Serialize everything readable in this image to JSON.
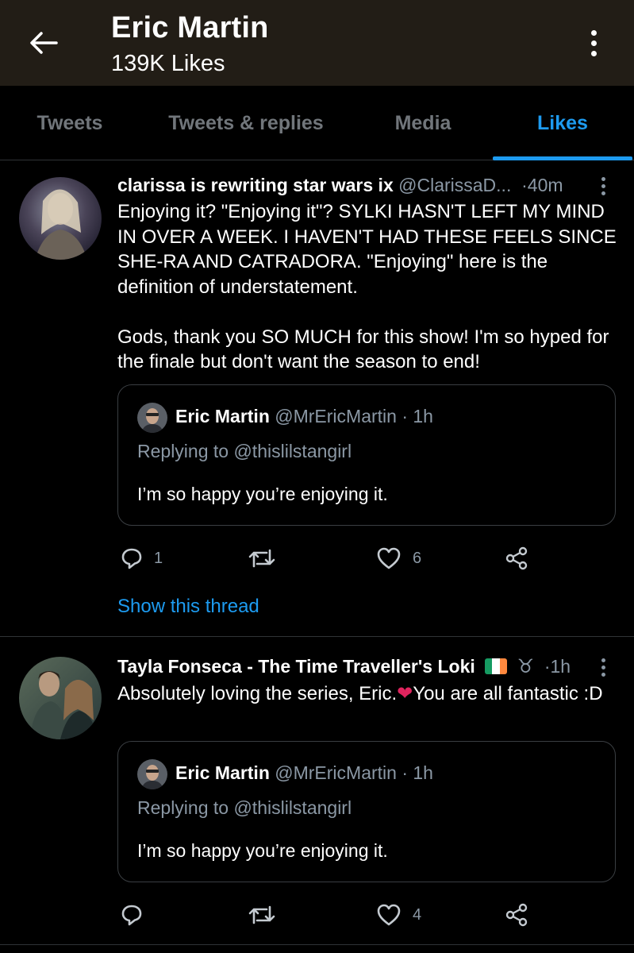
{
  "header": {
    "name": "Eric Martin",
    "subtitle": "139K Likes",
    "back_icon": "arrow-left-icon",
    "more_icon": "more-vertical-icon"
  },
  "tabs": [
    {
      "label": "Tweets",
      "active": false
    },
    {
      "label": "Tweets & replies",
      "active": false
    },
    {
      "label": "Media",
      "active": false
    },
    {
      "label": "Likes",
      "active": true
    }
  ],
  "tweets": [
    {
      "author": "clarissa is rewriting star wars ix",
      "handle": "@ClarissaD...",
      "time": "40m",
      "text": "Enjoying it? \"Enjoying it\"? SYLKI HASN'T LEFT MY MIND IN OVER A WEEK. I HAVEN'T HAD THESE FEELS SINCE SHE-RA AND CATRADORA. \"Enjoying\" here is the definition of understatement.\n\nGods, thank you SO MUCH for this show! I'm so hyped for the finale but don't want the season to end!",
      "quote": {
        "author": "Eric Martin",
        "meta": "@MrEricMartin · 1h",
        "replying": "Replying to @thislilstangirl",
        "text": "I’m so happy you’re enjoying it."
      },
      "replies": "1",
      "retweets": "",
      "likes": "6",
      "show_thread": "Show this thread"
    },
    {
      "author": "Tayla Fonseca - The Time Traveller's Loki",
      "time": "1h",
      "text_before": "Absolutely loving the series, Eric.",
      "text_emoji": "❤",
      "text_after": "You are all fantastic :D",
      "quote": {
        "author": "Eric Martin",
        "meta": "@MrEricMartin · 1h",
        "replying": "Replying to @thislilstangirl",
        "text": "I’m so happy you’re enjoying it."
      },
      "replies": "",
      "retweets": "",
      "likes": "4"
    }
  ],
  "colors": {
    "header_bg": "#221d16",
    "accent": "#1d9bf0",
    "muted": "#8b98a5",
    "divider": "#2f3336"
  }
}
